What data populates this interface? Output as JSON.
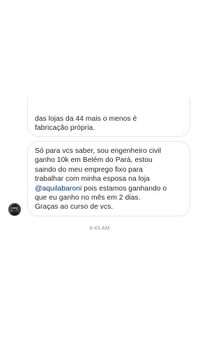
{
  "messages": {
    "previous": {
      "lines": [
        "das lojas da 44 mais o menos é",
        "fabricação própria."
      ]
    },
    "current": {
      "line_1": "Só para vcs saber, sou engenheiro civil",
      "line_2": "ganho 10k em Belém do Pará, estou",
      "line_3": "saindo do meu emprego fixo para",
      "line_4": "trabalhar com minha esposa na loja",
      "mention": "@aquilabaroni",
      "line_5_rest": " pois estamos ganhando o",
      "line_6": "que eu ganho no mês  em 2 dias.",
      "line_7": "Graças ao curso de vcs."
    }
  },
  "timestamp": "6:43 AM",
  "colors": {
    "bubble_border": "#e6e6e6",
    "text": "#262626",
    "mention": "#00376b",
    "timestamp": "#8e8e8e"
  }
}
